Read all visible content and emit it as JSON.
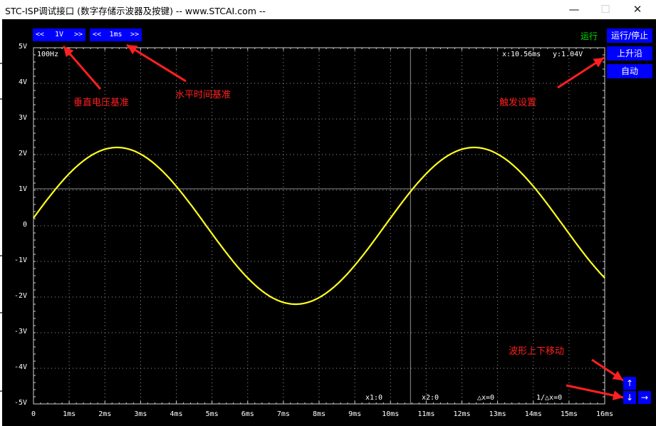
{
  "window": {
    "title": "STC-ISP调试接口 (数字存储示波器及按键) -- www.STCAI.com --",
    "minimize_glyph": "—",
    "maximize_glyph": "☐",
    "close_glyph": "✕"
  },
  "controls": {
    "volt": {
      "left": "<<",
      "value": "1V",
      "right": ">>"
    },
    "time": {
      "left": "<<",
      "value": "1ms",
      "right": ">>"
    }
  },
  "status": {
    "run_state": "运行"
  },
  "side_buttons": {
    "run_stop": "运行/停止",
    "trigger_edge": "上升沿",
    "trigger_mode": "自动"
  },
  "readouts": {
    "frequency": "100Hz",
    "cursor_x": "x:10.56ms",
    "cursor_y": "y:1.04V",
    "x1": "x1:0",
    "x2": "x2:0",
    "delta_x": "△x=0",
    "inv_delta_x": "1/△x=0"
  },
  "annotations": {
    "volt_base": "垂直电压基准",
    "time_base": "水平时间基准",
    "trigger_settings": "触发设置",
    "move_wave": "波形上下移动"
  },
  "nav": {
    "up": "↑",
    "down": "↓",
    "right": "→"
  },
  "colors": {
    "trace": "#ffff20",
    "button": "#0000ff",
    "annotation": "#ff2020",
    "status": "#00e000",
    "grid": "#b0b0b0"
  },
  "chart_data": {
    "type": "line",
    "title": "",
    "xlabel": "",
    "ylabel": "",
    "x_ticks": [
      "0",
      "1ms",
      "2ms",
      "3ms",
      "4ms",
      "5ms",
      "6ms",
      "7ms",
      "8ms",
      "9ms",
      "10ms",
      "11ms",
      "12ms",
      "13ms",
      "14ms",
      "15ms",
      "16ms"
    ],
    "y_ticks": [
      "5V",
      "4V",
      "3V",
      "2V",
      "1V",
      "0",
      "-1V",
      "-2V",
      "-3V",
      "-4V",
      "-5V"
    ],
    "xlim": [
      0,
      16
    ],
    "ylim": [
      -5,
      5
    ],
    "grid": true,
    "cursor": {
      "x": 10.56,
      "y": 1.04
    },
    "series": [
      {
        "waveform": "sine",
        "frequency_hz": 100,
        "amplitude_v": 2.2,
        "phase_deg": 5.7,
        "x_start_ms": 0,
        "x_end_ms": 16
      }
    ]
  }
}
